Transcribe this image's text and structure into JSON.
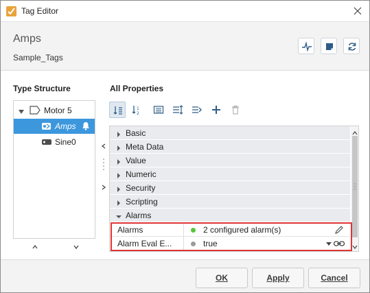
{
  "window": {
    "title": "Tag Editor"
  },
  "header": {
    "tag_name": "Amps",
    "tag_path": "Sample_Tags"
  },
  "type_structure": {
    "label": "Type Structure",
    "items": [
      {
        "label": "Motor 5"
      },
      {
        "label": "Amps"
      },
      {
        "label": "Sine0"
      }
    ]
  },
  "all_properties": {
    "label": "All Properties",
    "categories": [
      {
        "label": "Basic",
        "expanded": false
      },
      {
        "label": "Meta Data",
        "expanded": false
      },
      {
        "label": "Value",
        "expanded": false
      },
      {
        "label": "Numeric",
        "expanded": false
      },
      {
        "label": "Security",
        "expanded": false
      },
      {
        "label": "Scripting",
        "expanded": false
      },
      {
        "label": "Alarms",
        "expanded": true
      }
    ],
    "alarm_props": [
      {
        "name": "Alarms",
        "value": "2 configured alarm(s)",
        "status": "green",
        "icon": "pencil-icon"
      },
      {
        "name": "Alarm Eval E...",
        "value": "true",
        "status": "gray",
        "icon": "binding-icon"
      }
    ]
  },
  "footer": {
    "ok": "OK",
    "apply": "Apply",
    "cancel": "Cancel"
  },
  "colors": {
    "selection": "#3c97dd",
    "highlight": "#e03434",
    "status_green": "#58c63a",
    "status_gray": "#9a9a9a"
  }
}
